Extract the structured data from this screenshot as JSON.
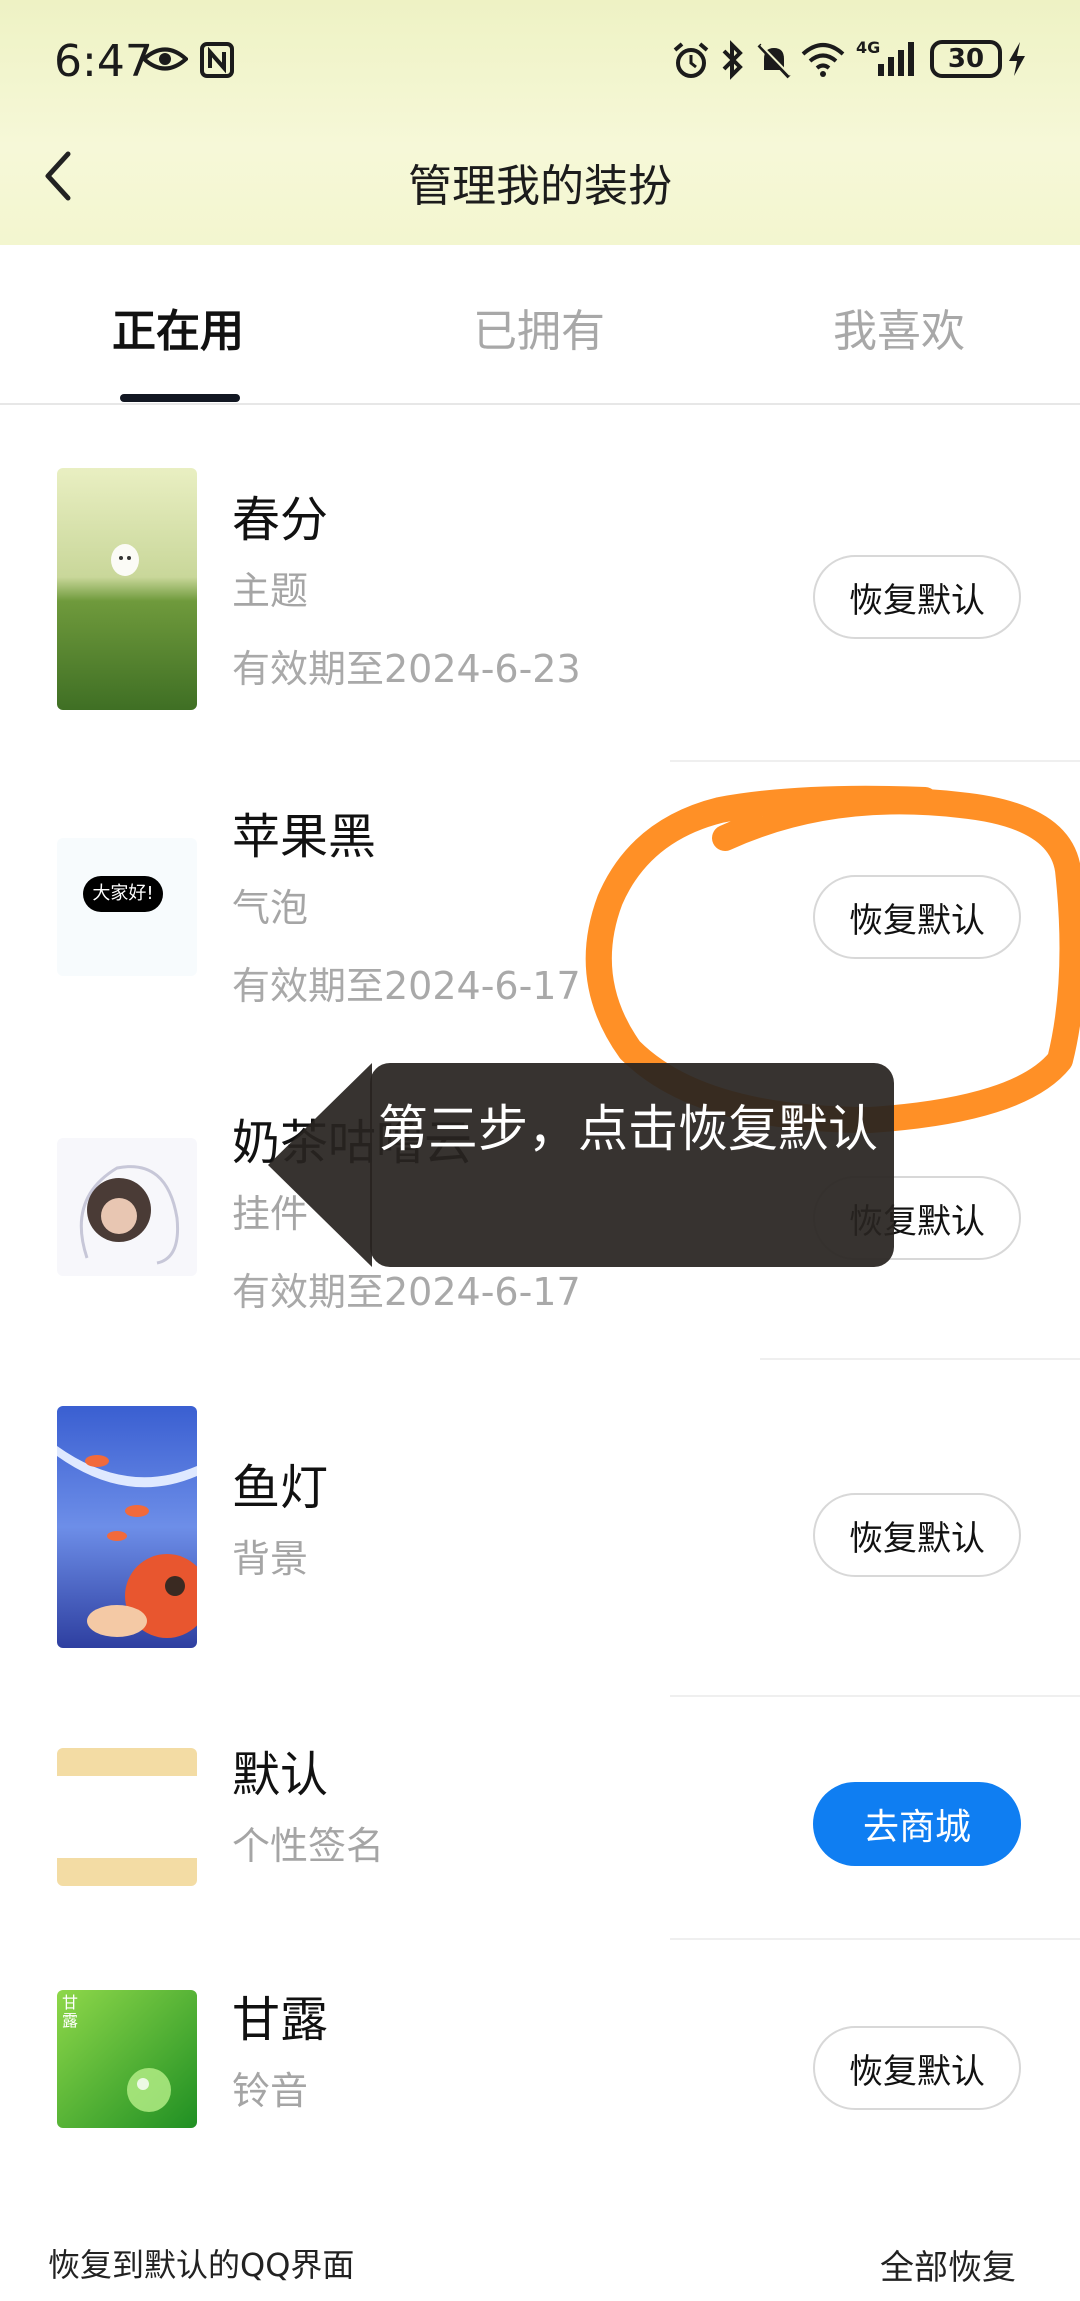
{
  "status_bar": {
    "time": "6:47",
    "battery": "30",
    "network": "4G",
    "icons": [
      "eye-icon",
      "nfc-icon",
      "alarm-icon",
      "bluetooth-icon",
      "mute-icon",
      "wifi-icon",
      "signal-icon",
      "battery-icon",
      "charging-icon"
    ]
  },
  "header": {
    "title": "管理我的装扮",
    "back_icon": "back-arrow-icon"
  },
  "tabs": [
    {
      "label": "正在用",
      "active": true
    },
    {
      "label": "已拥有",
      "active": false
    },
    {
      "label": "我喜欢",
      "active": false
    }
  ],
  "items": [
    {
      "name": "春分",
      "type": "主题",
      "expiry": "有效期至2024-6-23",
      "button": "恢复默认"
    },
    {
      "name": "苹果黑",
      "type": "气泡",
      "expiry": "有效期至2024-6-17",
      "button": "恢复默认",
      "thumb_text": "大家好!"
    },
    {
      "name": "奶茶咕噜云",
      "type": "挂件",
      "expiry": "有效期至2024-6-17",
      "button": "恢复默认"
    },
    {
      "name": "鱼灯",
      "type": "背景",
      "button": "恢复默认"
    },
    {
      "name": "默认",
      "type": "个性签名",
      "button": "去商城"
    },
    {
      "name": "甘露",
      "type": "铃音",
      "button": "恢复默认",
      "thumb_text": "甘露"
    }
  ],
  "footer": {
    "left_text": "恢复到默认的QQ界面",
    "right_text": "全部恢复"
  },
  "tooltip": {
    "text": "第三步，点击恢复默认"
  },
  "colors": {
    "accent": "#0f7ef2",
    "highlight": "#ff8a1a",
    "header_bg": "#eef2c4"
  }
}
